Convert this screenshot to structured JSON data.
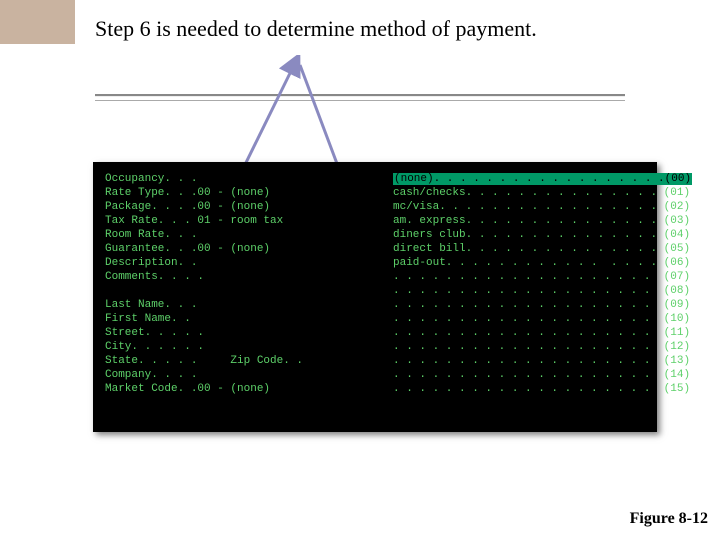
{
  "title": "Step 6 is needed to determine method of payment.",
  "figure_caption": "Figure 8-12",
  "terminal": {
    "left_lines": [
      "Occupancy. . .",
      "Rate Type. . .00 - (none)",
      "Package. . . .00 - (none)",
      "Tax Rate. . . 01 - room tax",
      "Room Rate. . .",
      "Guarantee. . .00 - (none)",
      "Description. .",
      "Comments. . . .",
      "",
      "Last Name. . .",
      "First Name. . ",
      "Street. . . . .",
      "City. . . . . .",
      "State. . . . .     Zip Code. .",
      "Company. . . .",
      "Market Code. .00 - (none)"
    ],
    "right_highlight_label": "(none). . . . . . . . . . . . . . . . . .",
    "right_highlight_code": "(00)",
    "right_lines": [
      "cash/checks. . . . . . . . . . . . . . . (01)",
      "mc/visa. . . . . . . . . . . . . . . . . (02)",
      "am. express. . . . . . . . . . . . . . . (03)",
      "diners club. . . . . . . . . . . . . . . (04)",
      "direct bill. . . . . . . . . . . . . . . (05)",
      "paid-out. . . . . . . . . . . .  . . . . (06)",
      ". . . . . . . . . . . . . . . . . . . .  (07)",
      ". . . . . . . . . . . . . . . . . . . .  (08)",
      ". . . . . . . . . . . . . . . . . . . .  (09)",
      ". . . . . . . . . . . . . . . . . . . .  (10)",
      ". . . . . . . . . . . . . . . . . . . .  (11)",
      ". . . . . . . . . . . . . . . . . . . .  (12)",
      ". . . . . . . . . . . . . . . . . . . .  (13)",
      ". . . . . . . . . . . . . . . . . . . .  (14)",
      ". . . . . . . . . . . . . . . . . . . .  (15)"
    ]
  }
}
